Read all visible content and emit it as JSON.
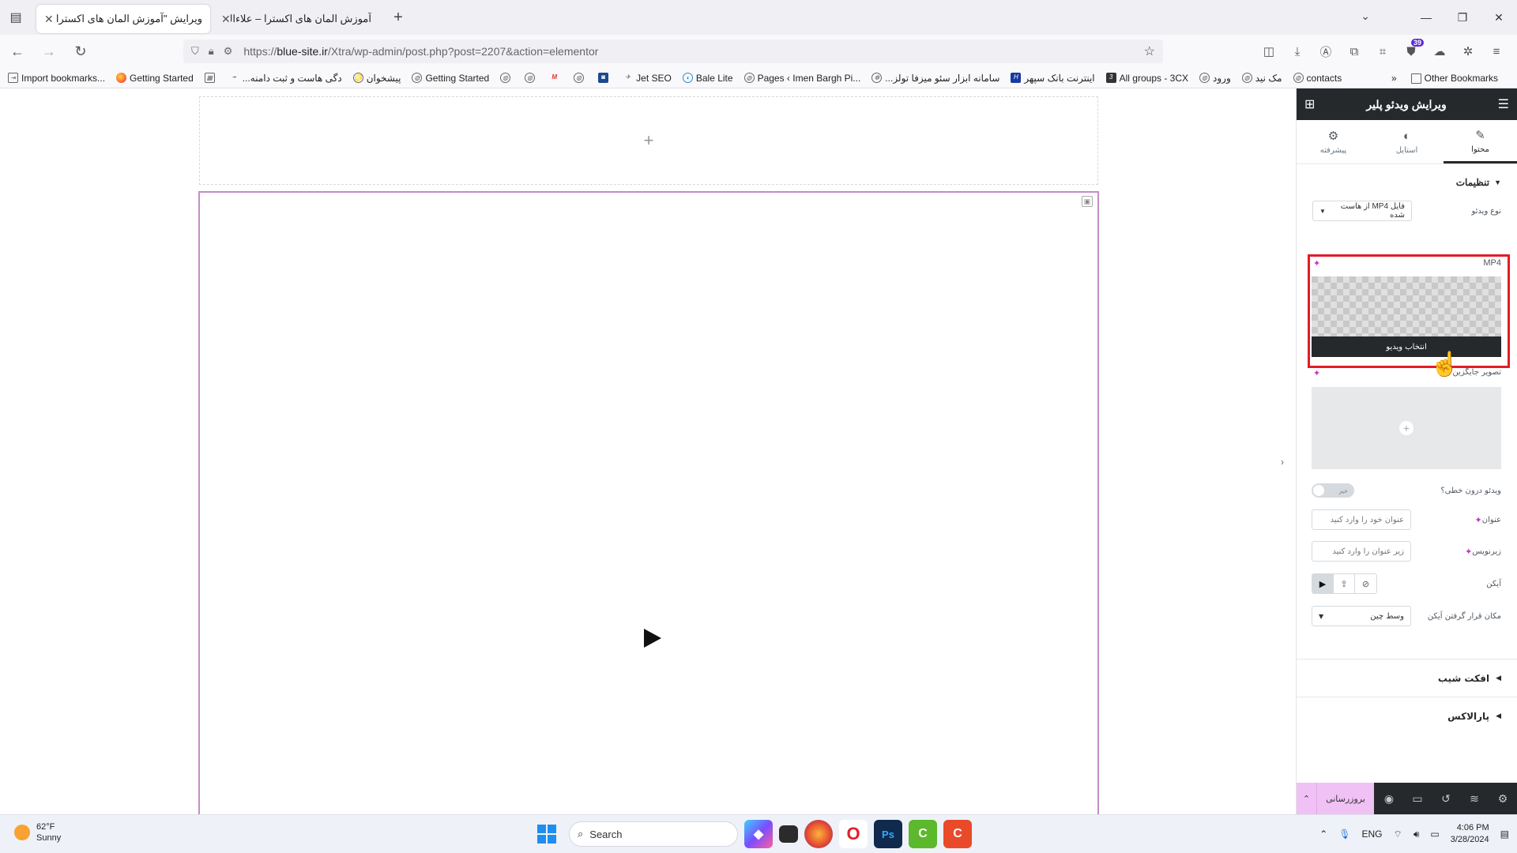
{
  "browser": {
    "tabs": [
      {
        "title": "ویرایش \"آموزش المان های اکسترا – ع",
        "active": true
      },
      {
        "title": "آموزش المان های اکسترا – علاءالدین",
        "active": false
      }
    ],
    "new_tab": "+",
    "url_prefix": "https://",
    "url_host": "blue-site.ir",
    "url_path": "/Xtra/wp-admin/post.php?post=2207&action=elementor",
    "extension_badge": "39"
  },
  "bookmarks": [
    {
      "label": "Import bookmarks...",
      "icon": "import-icon"
    },
    {
      "label": "Getting Started",
      "icon": "firefox-icon"
    },
    {
      "label": "",
      "icon": "calendar-icon"
    },
    {
      "label": "...دگی هاست و ثبت دامنه",
      "icon": "arrow-icon"
    },
    {
      "label": "پیشخوان",
      "icon": "lion-icon"
    },
    {
      "label": "Getting Started",
      "icon": "globe-icon"
    },
    {
      "label": "",
      "icon": "globe-icon"
    },
    {
      "label": "",
      "icon": "globe-icon"
    },
    {
      "label": "",
      "icon": "gmail-icon"
    },
    {
      "label": "",
      "icon": "globe-icon"
    },
    {
      "label": "",
      "icon": "app-icon"
    },
    {
      "label": "Jet SEO",
      "icon": "rocket-icon"
    },
    {
      "label": "Bale Lite",
      "icon": "bale-icon"
    },
    {
      "label": "Pages ‹ Imen Bargh Pi...",
      "icon": "globe-icon"
    },
    {
      "label": "...سامانه ابزار سئو میزفا تولز",
      "icon": "tools-icon"
    },
    {
      "label": "اینترنت بانک سپهر",
      "icon": "bank-icon"
    },
    {
      "label": "All groups - 3CX",
      "icon": "3cx-icon"
    },
    {
      "label": "ورود",
      "icon": "globe-icon"
    },
    {
      "label": "مک نید",
      "icon": "globe-icon"
    },
    {
      "label": "contacts",
      "icon": "globe-icon"
    }
  ],
  "bookmarks_other": "Other Bookmarks",
  "canvas": {
    "add_section": "+"
  },
  "panel": {
    "title": "ویرایش ویدئو پلیر",
    "tabs": [
      {
        "label": "محتوا",
        "icon": "pencil-icon"
      },
      {
        "label": "استایل",
        "icon": "contrast-icon"
      },
      {
        "label": "پیشرفته",
        "icon": "gear-icon"
      }
    ],
    "settings_heading": "تنظیمات",
    "video_type_label": "نوع ویدئو",
    "video_type_value": "فایل MP4 از هاست شده",
    "mp4_label": "MP4",
    "choose_video": "انتخاب ویدیو",
    "poster_label": "تصویر جایگزین",
    "inline_label": "ویدئو درون خطی؟",
    "inline_toggle": "خیر",
    "title_label": "عنوان",
    "title_placeholder": "عنوان خود را وارد کنید",
    "subtitle_label": "زیرنویس",
    "subtitle_placeholder": "زیر عنوان را وارد کنید",
    "icon_label": "آیکن",
    "icon_position_label": "مکان قرار گرفتن آیکن",
    "icon_position_value": "وسط چین",
    "section_tilt": "افکت شیب",
    "section_parallax": "پارالاکس",
    "update_button": "بروزرسانی"
  },
  "taskbar": {
    "temperature": "62°F",
    "weather": "Sunny",
    "search": "Search",
    "language": "ENG",
    "time": "4:06 PM",
    "date": "3/28/2024"
  },
  "colors": {
    "accent_highlight": "#e31c24",
    "panel_dark": "#26292c",
    "update_pink": "#f0c1f4",
    "widget_border": "#c48dc8"
  }
}
